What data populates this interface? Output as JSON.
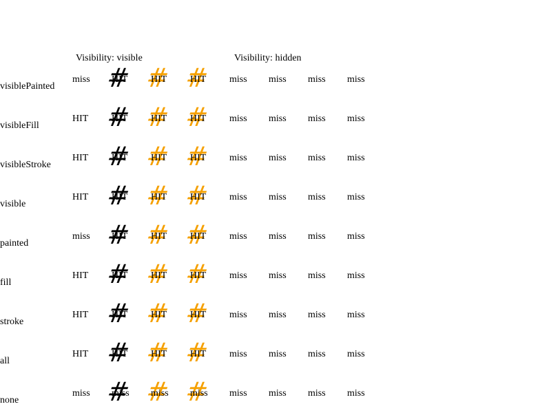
{
  "headers": {
    "visible": "Visibility: visible",
    "hidden": "Visibility: hidden"
  },
  "colors": {
    "hash_black": "#000000",
    "hash_orange": "#f5a000"
  },
  "icon": "hash-glyph",
  "glyph": "#",
  "rows": [
    {
      "label": "visiblePainted",
      "cells": [
        "miss",
        "HIT",
        "HIT",
        "HIT",
        "miss",
        "miss",
        "miss",
        "miss"
      ]
    },
    {
      "label": "visibleFill",
      "cells": [
        "HIT",
        "HIT",
        "HIT",
        "HIT",
        "miss",
        "miss",
        "miss",
        "miss"
      ]
    },
    {
      "label": "visibleStroke",
      "cells": [
        "HIT",
        "HIT",
        "HIT",
        "HIT",
        "miss",
        "miss",
        "miss",
        "miss"
      ]
    },
    {
      "label": "visible",
      "cells": [
        "HIT",
        "HIT",
        "HIT",
        "HIT",
        "miss",
        "miss",
        "miss",
        "miss"
      ]
    },
    {
      "label": "painted",
      "cells": [
        "miss",
        "HIT",
        "HIT",
        "HIT",
        "miss",
        "miss",
        "miss",
        "miss"
      ]
    },
    {
      "label": "fill",
      "cells": [
        "HIT",
        "HIT",
        "HIT",
        "HIT",
        "miss",
        "miss",
        "miss",
        "miss"
      ]
    },
    {
      "label": "stroke",
      "cells": [
        "HIT",
        "HIT",
        "HIT",
        "HIT",
        "miss",
        "miss",
        "miss",
        "miss"
      ]
    },
    {
      "label": "all",
      "cells": [
        "HIT",
        "HIT",
        "HIT",
        "HIT",
        "miss",
        "miss",
        "miss",
        "miss"
      ]
    },
    {
      "label": "none",
      "cells": [
        "miss",
        "miss",
        "miss",
        "miss",
        "miss",
        "miss",
        "miss",
        "miss"
      ]
    }
  ]
}
